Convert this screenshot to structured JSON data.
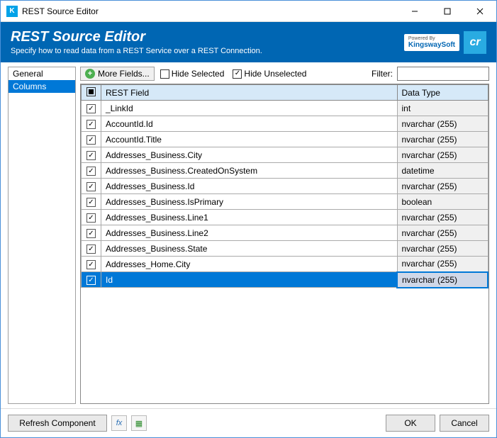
{
  "window": {
    "title": "REST Source Editor"
  },
  "header": {
    "title": "REST Source Editor",
    "subtitle": "Specify how to read data from a REST Service over a REST Connection.",
    "powered_by": "Powered By",
    "brand": "KingswaySoft",
    "logo2": "cr"
  },
  "sidebar": {
    "items": [
      {
        "label": "General",
        "selected": false
      },
      {
        "label": "Columns",
        "selected": true
      }
    ]
  },
  "toolbar": {
    "more_fields": "More Fields...",
    "hide_selected": {
      "label": "Hide Selected",
      "checked": false
    },
    "hide_unselected": {
      "label": "Hide Unselected",
      "checked": true
    },
    "filter_label": "Filter:",
    "filter_value": ""
  },
  "grid": {
    "headers": {
      "field": "REST Field",
      "type": "Data Type"
    },
    "rows": [
      {
        "checked": true,
        "field": "_LinkId",
        "type": "int",
        "selected": false
      },
      {
        "checked": true,
        "field": "AccountId.Id",
        "type": "nvarchar (255)",
        "selected": false
      },
      {
        "checked": true,
        "field": "AccountId.Title",
        "type": "nvarchar (255)",
        "selected": false
      },
      {
        "checked": true,
        "field": "Addresses_Business.City",
        "type": "nvarchar (255)",
        "selected": false
      },
      {
        "checked": true,
        "field": "Addresses_Business.CreatedOnSystem",
        "type": "datetime",
        "selected": false
      },
      {
        "checked": true,
        "field": "Addresses_Business.Id",
        "type": "nvarchar (255)",
        "selected": false
      },
      {
        "checked": true,
        "field": "Addresses_Business.IsPrimary",
        "type": "boolean",
        "selected": false
      },
      {
        "checked": true,
        "field": "Addresses_Business.Line1",
        "type": "nvarchar (255)",
        "selected": false
      },
      {
        "checked": true,
        "field": "Addresses_Business.Line2",
        "type": "nvarchar (255)",
        "selected": false
      },
      {
        "checked": true,
        "field": "Addresses_Business.State",
        "type": "nvarchar (255)",
        "selected": false
      },
      {
        "checked": true,
        "field": "Addresses_Home.City",
        "type": "nvarchar (255)",
        "selected": false
      },
      {
        "checked": true,
        "field": "Id",
        "type": "nvarchar (255)",
        "selected": true
      }
    ]
  },
  "footer": {
    "refresh": "Refresh Component",
    "ok": "OK",
    "cancel": "Cancel"
  }
}
